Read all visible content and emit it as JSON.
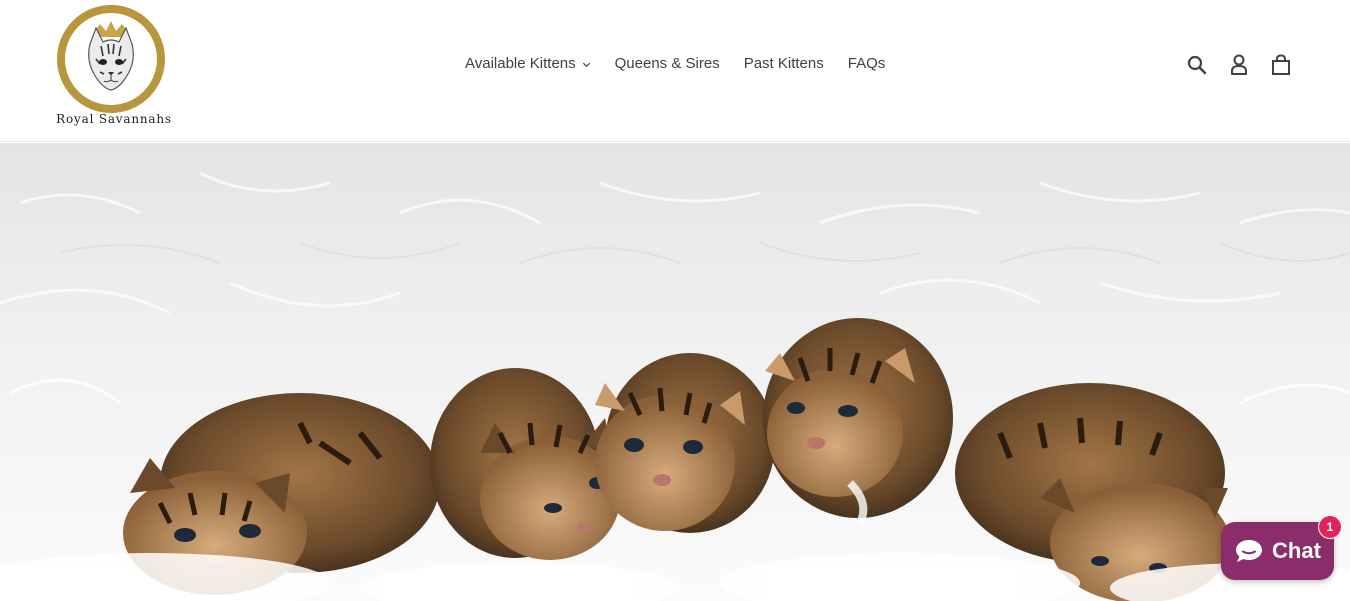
{
  "brand": {
    "name": "Royal Savannahs",
    "ring_color": "#b8963e"
  },
  "nav": {
    "items": [
      {
        "label": "Available Kittens",
        "has_dropdown": true
      },
      {
        "label": "Queens & Sires"
      },
      {
        "label": "Past Kittens"
      },
      {
        "label": "FAQs"
      }
    ]
  },
  "header_icons": [
    "search-icon",
    "account-icon",
    "cart-icon"
  ],
  "hero": {
    "subject": "kittens-on-white-fur-image"
  },
  "chat": {
    "label": "Chat",
    "badge_count": "1",
    "color": "#8c2d6b",
    "badge_color": "#e2245a"
  }
}
